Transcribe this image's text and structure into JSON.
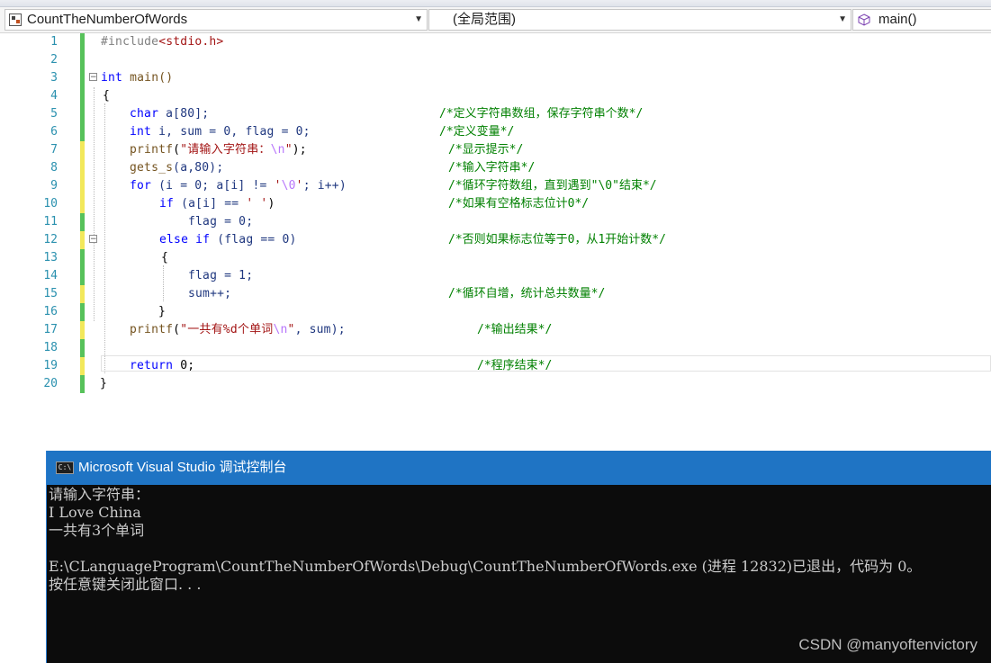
{
  "navbar": {
    "project": "CountTheNumberOfWords",
    "scope": "(全局范围)",
    "member": "main()"
  },
  "editor": {
    "line_numbers": [
      "1",
      "2",
      "3",
      "4",
      "5",
      "6",
      "7",
      "8",
      "9",
      "10",
      "11",
      "12",
      "13",
      "14",
      "15",
      "16",
      "17",
      "18",
      "19",
      "20"
    ],
    "comments": {
      "l5": "/*定义字符串数组，保存字符串个数*/",
      "l6": "/*定义变量*/",
      "l7": "/*显示提示*/",
      "l8": "/*输入字符串*/",
      "l9": "/*循环字符数组，直到遇到\"\\0\"结束*/",
      "l10": "/*如果有空格标志位计0*/",
      "l12": "/*否则如果标志位等于0，从1开始计数*/",
      "l15": "/*循环自增，统计总共数量*/",
      "l17": "/*输出结果*/",
      "l19": "/*程序结束*/"
    },
    "code": {
      "l1_pp": "#include",
      "l1_hdr": "<stdio.h>",
      "l3_kw": "int",
      "l3_rest": " main()",
      "l4": "{",
      "l5_kw": "char",
      "l5_rest": " a[80];",
      "l6_kw": "int",
      "l6_rest": " i, sum = 0, flag = 0;",
      "l7_fn": "printf",
      "l7_open": "(",
      "l7_str": "\"请输入字符串：",
      "l7_esc": "\\n",
      "l7_strend": "\"",
      "l7_close": ");",
      "l8_fn": "gets_s",
      "l8_rest": "(a,80);",
      "l9_kw": "for",
      "l9_a": " (i = 0; a[i] != ",
      "l9_str1": "'",
      "l9_esc": "\\0",
      "l9_str2": "'",
      "l9_b": "; i++)",
      "l10_kw": "if",
      "l10_a": " (a[i] == ",
      "l10_str": "' '",
      "l10_b": ")",
      "l11": "flag = 0;",
      "l12_kw1": "else",
      "l12_sp": " ",
      "l12_kw2": "if",
      "l12_rest": " (flag == 0)",
      "l13": "{",
      "l14": "flag = 1;",
      "l15": "sum++;",
      "l16": "}",
      "l17_fn": "printf",
      "l17_open": "(",
      "l17_str": "\"一共有%d个单词",
      "l17_esc": "\\n",
      "l17_strend": "\"",
      "l17_rest": ", sum);",
      "l19_kw": "return",
      "l19_rest": " 0;",
      "l20": "}"
    }
  },
  "console": {
    "title": "Microsoft Visual Studio 调试控制台",
    "icon_text": "C:\\",
    "lines": [
      "请输入字符串：",
      "I Love China",
      "一共有3个单词",
      "",
      "E:\\CLanguageProgram\\CountTheNumberOfWords\\Debug\\CountTheNumberOfWords.exe (进程 12832)已退出，代码为 0。",
      "按任意键关闭此窗口. . ."
    ]
  },
  "watermark": "CSDN @manyoftenvictory",
  "colors": {
    "change_green": "#57c25a",
    "change_yellow": "#f2e85a",
    "console_title": "#1f74c4"
  }
}
